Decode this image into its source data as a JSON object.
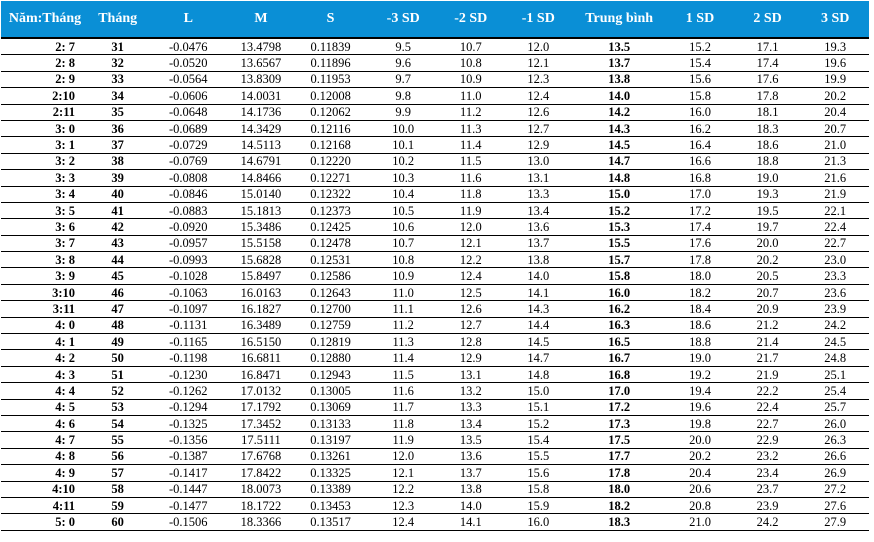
{
  "table": {
    "headers": [
      "Năm:Tháng",
      "Tháng",
      "L",
      "M",
      "S",
      "-3 SD",
      "-2 SD",
      "-1 SD",
      "Trung bình",
      "1 SD",
      "2 SD",
      "3 SD"
    ],
    "rows": [
      [
        "2: 7",
        "31",
        "-0.0476",
        "13.4798",
        "0.11839",
        "9.5",
        "10.7",
        "12.0",
        "13.5",
        "15.2",
        "17.1",
        "19.3"
      ],
      [
        "2: 8",
        "32",
        "-0.0520",
        "13.6567",
        "0.11896",
        "9.6",
        "10.8",
        "12.1",
        "13.7",
        "15.4",
        "17.4",
        "19.6"
      ],
      [
        "2: 9",
        "33",
        "-0.0564",
        "13.8309",
        "0.11953",
        "9.7",
        "10.9",
        "12.3",
        "13.8",
        "15.6",
        "17.6",
        "19.9"
      ],
      [
        "2:10",
        "34",
        "-0.0606",
        "14.0031",
        "0.12008",
        "9.8",
        "11.0",
        "12.4",
        "14.0",
        "15.8",
        "17.8",
        "20.2"
      ],
      [
        "2:11",
        "35",
        "-0.0648",
        "14.1736",
        "0.12062",
        "9.9",
        "11.2",
        "12.6",
        "14.2",
        "16.0",
        "18.1",
        "20.4"
      ],
      [
        "3: 0",
        "36",
        "-0.0689",
        "14.3429",
        "0.12116",
        "10.0",
        "11.3",
        "12.7",
        "14.3",
        "16.2",
        "18.3",
        "20.7"
      ],
      [
        "3: 1",
        "37",
        "-0.0729",
        "14.5113",
        "0.12168",
        "10.1",
        "11.4",
        "12.9",
        "14.5",
        "16.4",
        "18.6",
        "21.0"
      ],
      [
        "3: 2",
        "38",
        "-0.0769",
        "14.6791",
        "0.12220",
        "10.2",
        "11.5",
        "13.0",
        "14.7",
        "16.6",
        "18.8",
        "21.3"
      ],
      [
        "3: 3",
        "39",
        "-0.0808",
        "14.8466",
        "0.12271",
        "10.3",
        "11.6",
        "13.1",
        "14.8",
        "16.8",
        "19.0",
        "21.6"
      ],
      [
        "3: 4",
        "40",
        "-0.0846",
        "15.0140",
        "0.12322",
        "10.4",
        "11.8",
        "13.3",
        "15.0",
        "17.0",
        "19.3",
        "21.9"
      ],
      [
        "3: 5",
        "41",
        "-0.0883",
        "15.1813",
        "0.12373",
        "10.5",
        "11.9",
        "13.4",
        "15.2",
        "17.2",
        "19.5",
        "22.1"
      ],
      [
        "3: 6",
        "42",
        "-0.0920",
        "15.3486",
        "0.12425",
        "10.6",
        "12.0",
        "13.6",
        "15.3",
        "17.4",
        "19.7",
        "22.4"
      ],
      [
        "3: 7",
        "43",
        "-0.0957",
        "15.5158",
        "0.12478",
        "10.7",
        "12.1",
        "13.7",
        "15.5",
        "17.6",
        "20.0",
        "22.7"
      ],
      [
        "3: 8",
        "44",
        "-0.0993",
        "15.6828",
        "0.12531",
        "10.8",
        "12.2",
        "13.8",
        "15.7",
        "17.8",
        "20.2",
        "23.0"
      ],
      [
        "3: 9",
        "45",
        "-0.1028",
        "15.8497",
        "0.12586",
        "10.9",
        "12.4",
        "14.0",
        "15.8",
        "18.0",
        "20.5",
        "23.3"
      ],
      [
        "3:10",
        "46",
        "-0.1063",
        "16.0163",
        "0.12643",
        "11.0",
        "12.5",
        "14.1",
        "16.0",
        "18.2",
        "20.7",
        "23.6"
      ],
      [
        "3:11",
        "47",
        "-0.1097",
        "16.1827",
        "0.12700",
        "11.1",
        "12.6",
        "14.3",
        "16.2",
        "18.4",
        "20.9",
        "23.9"
      ],
      [
        "4: 0",
        "48",
        "-0.1131",
        "16.3489",
        "0.12759",
        "11.2",
        "12.7",
        "14.4",
        "16.3",
        "18.6",
        "21.2",
        "24.2"
      ],
      [
        "4: 1",
        "49",
        "-0.1165",
        "16.5150",
        "0.12819",
        "11.3",
        "12.8",
        "14.5",
        "16.5",
        "18.8",
        "21.4",
        "24.5"
      ],
      [
        "4: 2",
        "50",
        "-0.1198",
        "16.6811",
        "0.12880",
        "11.4",
        "12.9",
        "14.7",
        "16.7",
        "19.0",
        "21.7",
        "24.8"
      ],
      [
        "4: 3",
        "51",
        "-0.1230",
        "16.8471",
        "0.12943",
        "11.5",
        "13.1",
        "14.8",
        "16.8",
        "19.2",
        "21.9",
        "25.1"
      ],
      [
        "4: 4",
        "52",
        "-0.1262",
        "17.0132",
        "0.13005",
        "11.6",
        "13.2",
        "15.0",
        "17.0",
        "19.4",
        "22.2",
        "25.4"
      ],
      [
        "4: 5",
        "53",
        "-0.1294",
        "17.1792",
        "0.13069",
        "11.7",
        "13.3",
        "15.1",
        "17.2",
        "19.6",
        "22.4",
        "25.7"
      ],
      [
        "4: 6",
        "54",
        "-0.1325",
        "17.3452",
        "0.13133",
        "11.8",
        "13.4",
        "15.2",
        "17.3",
        "19.8",
        "22.7",
        "26.0"
      ],
      [
        "4: 7",
        "55",
        "-0.1356",
        "17.5111",
        "0.13197",
        "11.9",
        "13.5",
        "15.4",
        "17.5",
        "20.0",
        "22.9",
        "26.3"
      ],
      [
        "4: 8",
        "56",
        "-0.1387",
        "17.6768",
        "0.13261",
        "12.0",
        "13.6",
        "15.5",
        "17.7",
        "20.2",
        "23.2",
        "26.6"
      ],
      [
        "4: 9",
        "57",
        "-0.1417",
        "17.8422",
        "0.13325",
        "12.1",
        "13.7",
        "15.6",
        "17.8",
        "20.4",
        "23.4",
        "26.9"
      ],
      [
        "4:10",
        "58",
        "-0.1447",
        "18.0073",
        "0.13389",
        "12.2",
        "13.8",
        "15.8",
        "18.0",
        "20.6",
        "23.7",
        "27.2"
      ],
      [
        "4:11",
        "59",
        "-0.1477",
        "18.1722",
        "0.13453",
        "12.3",
        "14.0",
        "15.9",
        "18.2",
        "20.8",
        "23.9",
        "27.6"
      ],
      [
        "5: 0",
        "60",
        "-0.1506",
        "18.3366",
        "0.13517",
        "12.4",
        "14.1",
        "16.0",
        "18.3",
        "21.0",
        "24.2",
        "27.9"
      ]
    ]
  },
  "colors": {
    "header_bg": "#0a8fd6",
    "header_text": "#ffffff",
    "row_rule": "#000000"
  }
}
